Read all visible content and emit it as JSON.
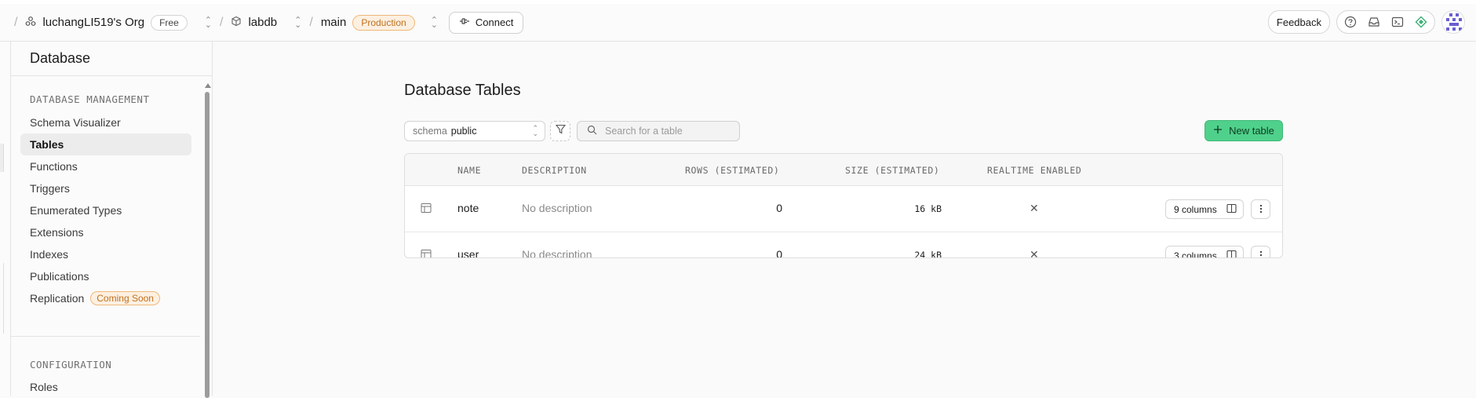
{
  "topbar": {
    "org_name": "luchangLI519's Org",
    "org_plan": "Free",
    "project": "labdb",
    "branch": "main",
    "env_badge": "Production",
    "connect_label": "Connect",
    "feedback_label": "Feedback",
    "icons": [
      "help-icon",
      "inbox-icon",
      "terminal-icon",
      "assistant-icon"
    ]
  },
  "sidebar": {
    "title": "Database",
    "section1": "DATABASE MANAGEMENT",
    "items": [
      {
        "label": "Schema Visualizer",
        "active": false
      },
      {
        "label": "Tables",
        "active": true
      },
      {
        "label": "Functions",
        "active": false
      },
      {
        "label": "Triggers",
        "active": false
      },
      {
        "label": "Enumerated Types",
        "active": false
      },
      {
        "label": "Extensions",
        "active": false
      },
      {
        "label": "Indexes",
        "active": false
      },
      {
        "label": "Publications",
        "active": false
      },
      {
        "label": "Replication",
        "active": false,
        "badge": "Coming Soon"
      }
    ],
    "section2": "CONFIGURATION",
    "roles": "Roles"
  },
  "main": {
    "title": "Database Tables",
    "schema_label": "schema",
    "schema_value": "public",
    "search_placeholder": "Search for a table",
    "new_table_label": "New table",
    "columns": [
      "NAME",
      "DESCRIPTION",
      "ROWS (ESTIMATED)",
      "SIZE (ESTIMATED)",
      "REALTIME ENABLED"
    ],
    "rows": [
      {
        "name": "note",
        "description": "No description",
        "rows": "0",
        "size": "16 kB",
        "realtime": "✕",
        "columns_label": "9 columns"
      },
      {
        "name": "user",
        "description": "No description",
        "rows": "0",
        "size": "24 kB",
        "realtime": "✕",
        "columns_label": "3 columns"
      }
    ]
  },
  "colors": {
    "accent_green": "#4fd18b",
    "production_orange": "#c0701d"
  }
}
